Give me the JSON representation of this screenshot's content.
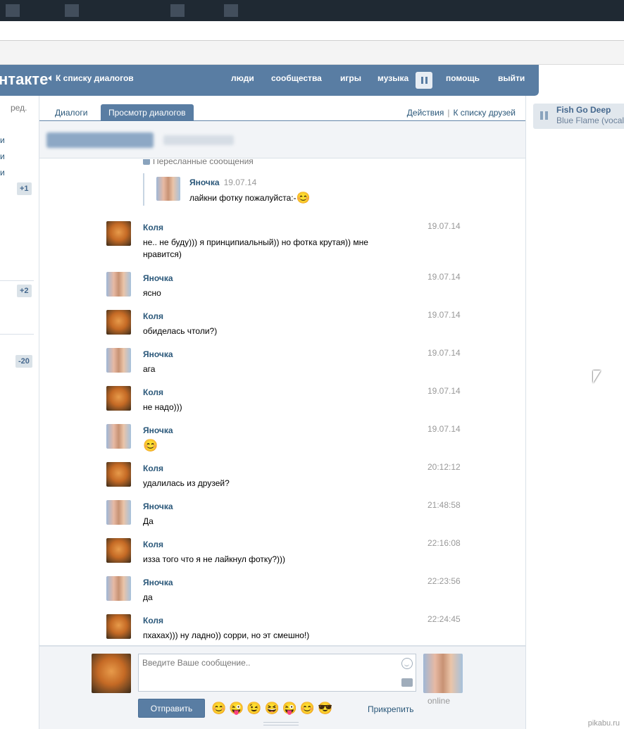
{
  "header": {
    "logo": "нтакте",
    "back_link": "К списку диалогов",
    "nav": [
      "люди",
      "сообщества",
      "игры",
      "музыка",
      "помощь",
      "выйти"
    ]
  },
  "sidebar": {
    "edit": "ред.",
    "fragments": [
      "и",
      "и",
      "и"
    ],
    "badges": [
      "+1",
      "+2",
      "-20"
    ]
  },
  "tabs": {
    "dialogs": "Диалоги",
    "view": "Просмотр диалогов",
    "actions": "Действия",
    "separator": "|",
    "friends_link": "К списку друзей"
  },
  "forwarded": {
    "title": "Пересланные сообщения",
    "author": "Яночка",
    "date": "19.07.14",
    "text": "лайкни фотку пожалуйста:-",
    "emoji": "😊"
  },
  "messages": [
    {
      "author": "Коля",
      "avatar": "fox",
      "text": "не.. не буду))) я принципиальный)) но фотка крутая)) мне нравится)",
      "time": "19.07.14"
    },
    {
      "author": "Яночка",
      "avatar": "girls",
      "text": "ясно",
      "time": "19.07.14"
    },
    {
      "author": "Коля",
      "avatar": "fox",
      "text": "обиделась чтоли?)",
      "time": "19.07.14"
    },
    {
      "author": "Яночка",
      "avatar": "girls",
      "text": "ага",
      "time": "19.07.14"
    },
    {
      "author": "Коля",
      "avatar": "fox",
      "text": "не надо)))",
      "time": "19.07.14"
    },
    {
      "author": "Яночка",
      "avatar": "girls",
      "text": "😊",
      "time": "19.07.14"
    },
    {
      "author": "Коля",
      "avatar": "fox",
      "text": "удалилась из друзей?",
      "time": "20:12:12"
    },
    {
      "author": "Яночка",
      "avatar": "girls",
      "text": "Да",
      "time": "21:48:58"
    },
    {
      "author": "Коля",
      "avatar": "fox",
      "text": "изза того что я не лайкнул фотку?)))",
      "time": "22:16:08"
    },
    {
      "author": "Яночка",
      "avatar": "girls",
      "text": "да",
      "time": "22:23:56"
    },
    {
      "author": "Коля",
      "avatar": "fox",
      "text": "пхахах))) ну ладно)) сорри, но эт смешно!)",
      "time": "22:24:45"
    }
  ],
  "compose": {
    "placeholder": "Введите Ваше сообщение..",
    "send": "Отправить",
    "attach": "Прикрепить",
    "online": "online",
    "emojis": [
      "😊",
      "😜",
      "😉",
      "😆",
      "😜",
      "😊",
      "😎"
    ]
  },
  "audio": {
    "artist": "Fish Go Deep",
    "track": "Blue Flame (vocal"
  },
  "watermark": "pikabu.ru"
}
